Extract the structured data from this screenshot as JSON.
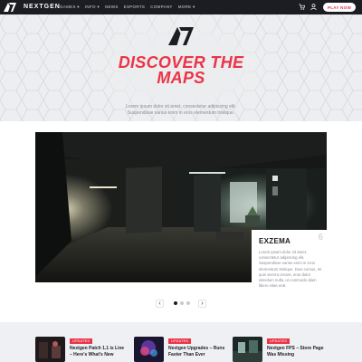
{
  "nav": {
    "brand": "NEXTGEN",
    "menu": [
      "GAMES ▾",
      "INFO ▾",
      "NEWS",
      "ESPORTS",
      "COMPANY",
      "MORE ▾"
    ],
    "play_label": "PLAY NOW",
    "icons": [
      "logo-mark",
      "cart-icon",
      "user-icon"
    ]
  },
  "hero": {
    "title_line1": "DISCOVER THE",
    "title_line2": "MAPS",
    "desc_line1": "Lorem ipsum dolor sit amet, consectetur adipiscing elit.",
    "desc_line2": "Suspendisse varius enim in eros elementum tristique."
  },
  "slider": {
    "card_title": "EXZEMA",
    "card_number": "6",
    "card_text": "Lorem ipsum dolor sit amet, consectetur adipiscing elit. Suspendisse varius enim in eros elementum tristique. Duis cursus, mi quis viverra ornare, eros dolor interdum nulla, ut commodo diam libero vitae erat.",
    "prev_label": "‹",
    "next_label": "›",
    "slide_count": 3,
    "active_slide": 1
  },
  "news": [
    {
      "tag": "UPDATES",
      "title": "Nextgen Patch 1.1 is Live – Here's What's New"
    },
    {
      "tag": "UPDATES",
      "title": "Nextgen Upgrades – Runs Faster Than Ever"
    },
    {
      "tag": "UPDATES",
      "title": "Nextgen FPS – Store Page Was Missing"
    }
  ],
  "colors": {
    "accent": "#ea3447",
    "dark": "#1c1d22",
    "muted": "#8a8c94"
  }
}
